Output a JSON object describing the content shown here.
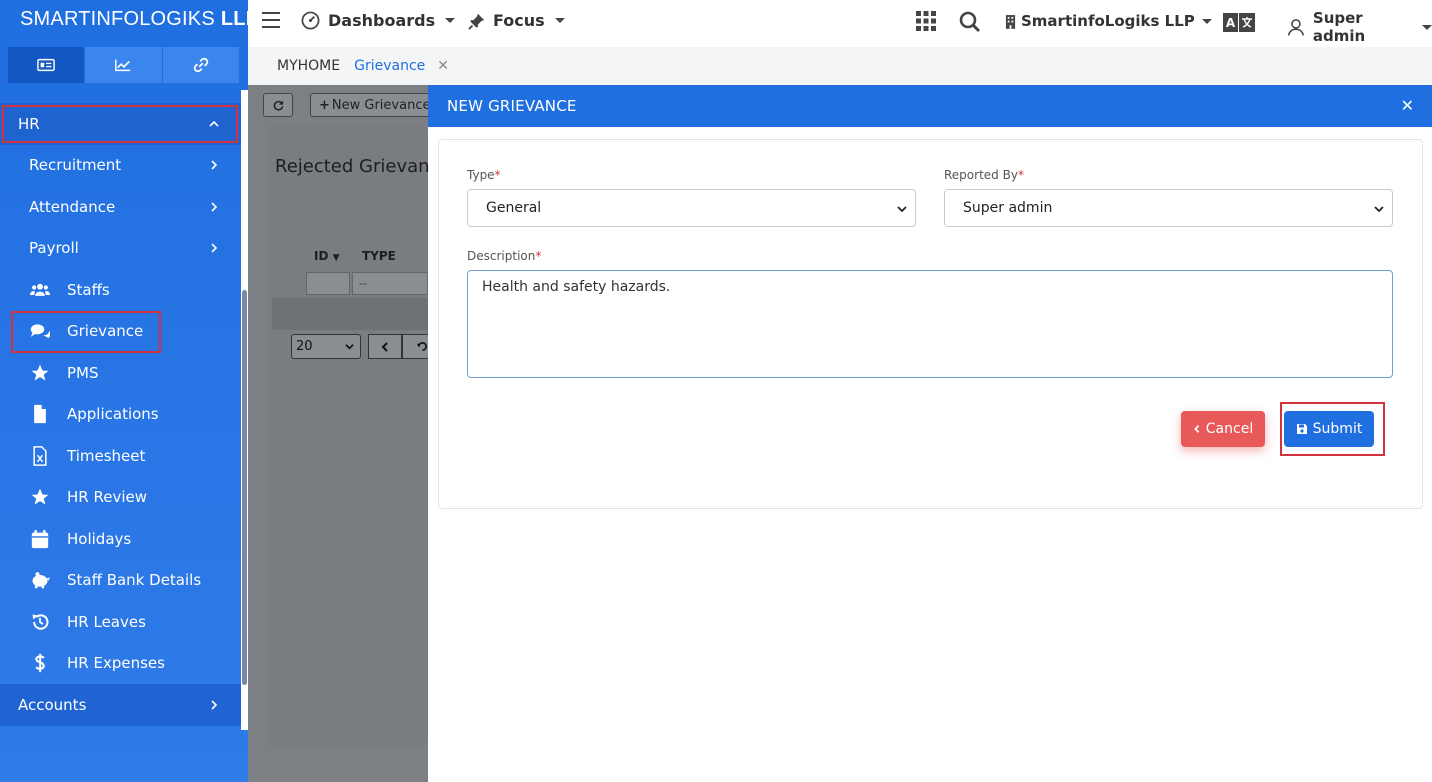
{
  "brand": {
    "name": "SMARTINFOLOGIKS",
    "suffix": "LLP"
  },
  "sidebar": {
    "tabs": [
      {
        "icon": "id-card-icon"
      },
      {
        "icon": "chart-line-icon"
      },
      {
        "icon": "link-icon"
      }
    ],
    "section": "HR",
    "sub_items": [
      "Recruitment",
      "Attendance",
      "Payroll"
    ],
    "items": [
      {
        "label": "Staffs",
        "icon": "users-icon"
      },
      {
        "label": "Grievance",
        "icon": "comments-icon"
      },
      {
        "label": "PMS",
        "icon": "star-icon"
      },
      {
        "label": "Applications",
        "icon": "file-icon"
      },
      {
        "label": "Timesheet",
        "icon": "file-excel-icon"
      },
      {
        "label": "HR Review",
        "icon": "star-icon"
      },
      {
        "label": "Holidays",
        "icon": "calendar-icon"
      },
      {
        "label": "Staff Bank Details",
        "icon": "piggy-bank-icon"
      },
      {
        "label": "HR Leaves",
        "icon": "history-icon"
      },
      {
        "label": "HR Expenses",
        "icon": "dollar-icon"
      }
    ],
    "accounts": "Accounts"
  },
  "topbar": {
    "dashboards": "Dashboards",
    "focus": "Focus",
    "company": "SmartinfoLogiks LLP",
    "user": "Super admin"
  },
  "tabs": {
    "home": "MYHOME",
    "current": "Grievance"
  },
  "background_page": {
    "new_button": "New Grievance",
    "title": "Rejected Grievanc",
    "col_id": "ID",
    "col_type": "TYPE",
    "filter_placeholder": "--",
    "page_size": "20"
  },
  "drawer": {
    "title": "NEW GRIEVANCE",
    "type_label": "Type",
    "type_value": "General",
    "reported_label": "Reported By",
    "reported_value": "Super admin",
    "desc_label": "Description",
    "desc_value": "Health and safety hazards.",
    "cancel": "Cancel",
    "submit": "Submit"
  },
  "colors": {
    "primary": "#1f6fe0",
    "danger": "#e85a5a",
    "highlight": "#d1333c"
  }
}
